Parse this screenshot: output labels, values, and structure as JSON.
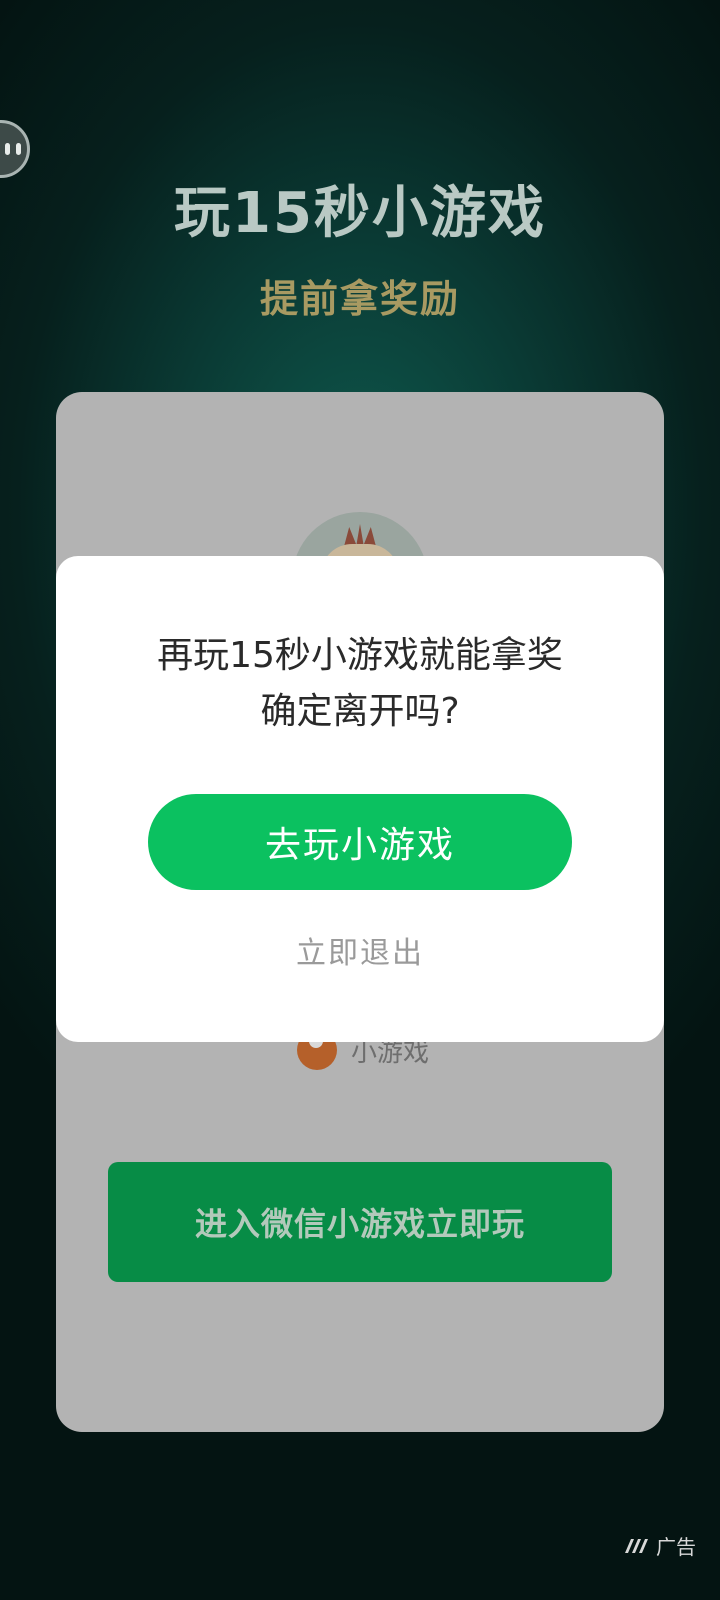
{
  "header": {
    "title": "玩15秒小游戏",
    "subtitle": "提前拿奖励"
  },
  "card": {
    "brand_label": "小游戏",
    "enter_button_label": "进入微信小游戏立即玩"
  },
  "dialog": {
    "message_line1": "再玩15秒小游戏就能拿奖",
    "message_line2": "确定离开吗?",
    "primary_button_label": "去玩小游戏",
    "secondary_link_label": "立即退出"
  },
  "ad": {
    "label": "广告"
  },
  "colors": {
    "primary_green": "#0bc160",
    "dark_green_button": "#078c46",
    "subtitle_gold": "#a89a62"
  }
}
